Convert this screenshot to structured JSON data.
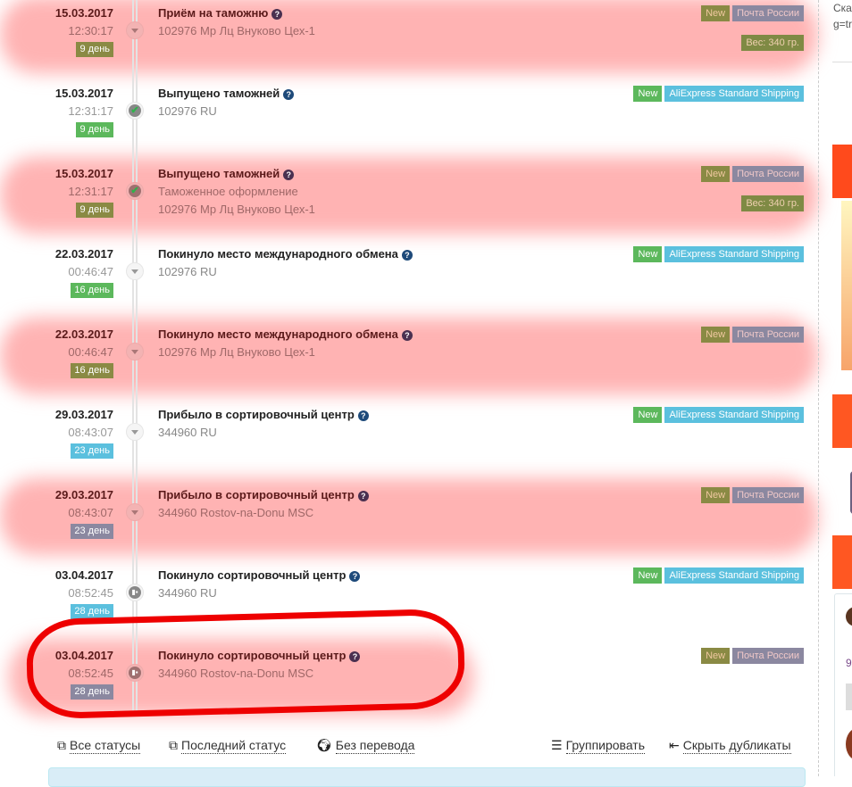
{
  "colors": {
    "highlight": "#ff9696",
    "tag_new": "#5cb85c",
    "tag_aliexpress": "#5bc0de",
    "tag_post_russia": "#8b88a0",
    "annotation_red": "#ee0000",
    "day_green": "#5cb85c",
    "day_blue": "#5bc0de"
  },
  "events": [
    {
      "date": "15.03.2017",
      "time": "12:30:17",
      "day": "9 день",
      "title": "Приём на таможню",
      "lines": [
        "102976 Мр Лц Внуково Цех-1"
      ],
      "tags": [
        "New",
        "Почта России"
      ],
      "weight": "Вес: 340 гр.",
      "source": "post",
      "icon": "caret-down-icon"
    },
    {
      "date": "15.03.2017",
      "time": "12:31:17",
      "day": "9 день",
      "title": "Выпущено таможней",
      "lines": [
        "102976 RU"
      ],
      "tags": [
        "New",
        "AliExpress Standard Shipping"
      ],
      "source": "ali",
      "icon": "clock-check-icon"
    },
    {
      "date": "15.03.2017",
      "time": "12:31:17",
      "day": "9 день",
      "title": "Выпущено таможней",
      "lines": [
        "Таможенное оформление",
        "102976 Мр Лц Внуково Цех-1"
      ],
      "tags": [
        "New",
        "Почта России"
      ],
      "weight": "Вес: 340 гр.",
      "source": "post",
      "icon": "clock-check-icon"
    },
    {
      "date": "22.03.2017",
      "time": "00:46:47",
      "day": "16 день",
      "title": "Покинуло место международного обмена",
      "lines": [
        "102976 RU"
      ],
      "tags": [
        "New",
        "AliExpress Standard Shipping"
      ],
      "source": "ali",
      "icon": "caret-down-icon"
    },
    {
      "date": "22.03.2017",
      "time": "00:46:47",
      "day": "16 день",
      "title": "Покинуло место международного обмена",
      "lines": [
        "102976 Мр Лц Внуково Цех-1"
      ],
      "tags": [
        "New",
        "Почта России"
      ],
      "source": "post",
      "icon": "caret-down-icon"
    },
    {
      "date": "29.03.2017",
      "time": "08:43:07",
      "day": "23 день",
      "title": "Прибыло в сортировочный центр",
      "lines": [
        "344960 RU"
      ],
      "tags": [
        "New",
        "AliExpress Standard Shipping"
      ],
      "source": "ali",
      "icon": "caret-down-icon"
    },
    {
      "date": "29.03.2017",
      "time": "08:43:07",
      "day": "23 день",
      "title": "Прибыло в сортировочный центр",
      "lines": [
        "344960 Rostov-na-Donu MSC"
      ],
      "tags": [
        "New",
        "Почта России"
      ],
      "source": "post",
      "icon": "caret-down-icon"
    },
    {
      "date": "03.04.2017",
      "time": "08:52:45",
      "day": "28 день",
      "title": "Покинуло сортировочный центр",
      "lines": [
        "344960 RU"
      ],
      "tags": [
        "New",
        "AliExpress Standard Shipping"
      ],
      "source": "ali",
      "icon": "truck-icon"
    },
    {
      "date": "03.04.2017",
      "time": "08:52:45",
      "day": "28 день",
      "title": "Покинуло сортировочный центр",
      "lines": [
        "344960 Rostov-na-Donu MSC"
      ],
      "tags": [
        "New",
        "Почта России"
      ],
      "source": "post",
      "icon": "truck-icon"
    }
  ],
  "footer": {
    "all_statuses": "Все статусы",
    "last_status": "Последний статус",
    "no_translation": "Без перевода",
    "group": "Группировать",
    "hide_duplicates": "Скрыть дубликаты"
  },
  "sidebar": {
    "text_line1": "Ска",
    "text_line2": "g=tr",
    "count": "9"
  }
}
